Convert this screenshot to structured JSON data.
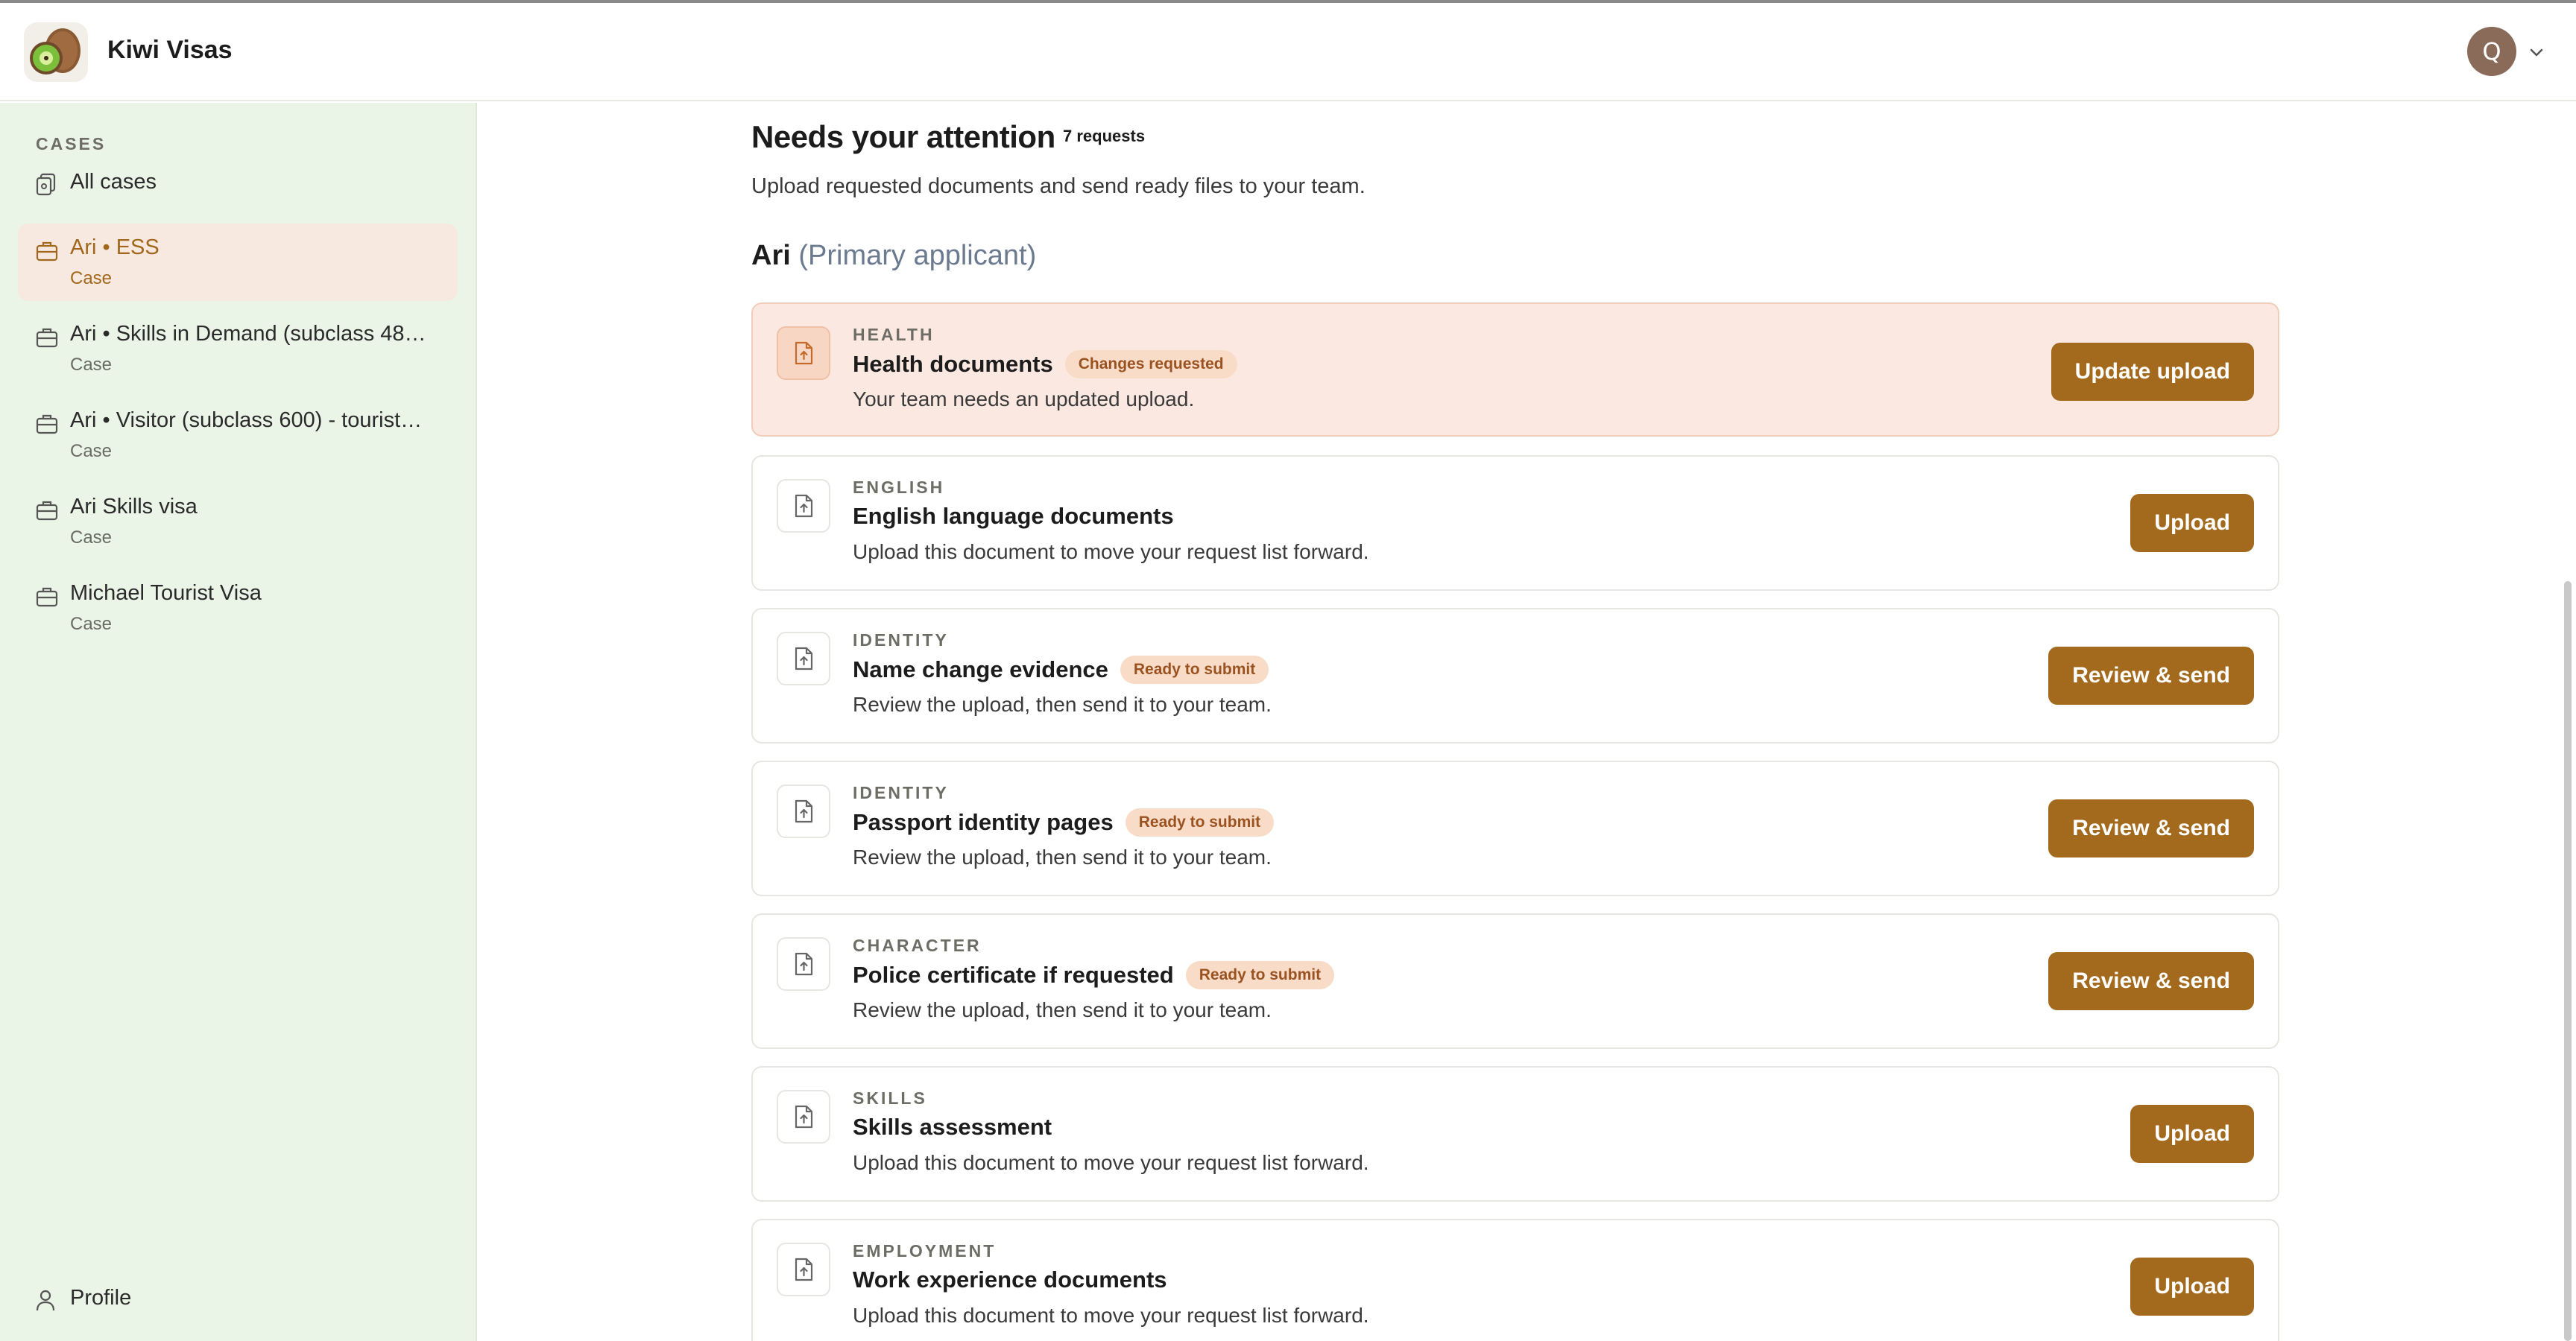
{
  "app": {
    "title": "Kiwi Visas",
    "avatar_initial": "Q"
  },
  "sidebar": {
    "section_label": "CASES",
    "items": [
      {
        "label": "All cases",
        "sub": "",
        "icon": "cases-icon",
        "active": false
      },
      {
        "label": "Ari • ESS",
        "sub": "Case",
        "icon": "briefcase-icon",
        "active": true
      },
      {
        "label": "Ari • Skills in Demand (subclass 48…",
        "sub": "Case",
        "icon": "briefcase-icon",
        "active": false
      },
      {
        "label": "Ari • Visitor (subclass 600) - tourist…",
        "sub": "Case",
        "icon": "briefcase-icon",
        "active": false
      },
      {
        "label": "Ari Skills visa",
        "sub": "Case",
        "icon": "briefcase-icon",
        "active": false
      },
      {
        "label": "Michael Tourist Visa",
        "sub": "Case",
        "icon": "briefcase-icon",
        "active": false
      }
    ],
    "profile_label": "Profile"
  },
  "main": {
    "heading": "Needs your attention",
    "count": "7 requests",
    "subheading": "Upload requested documents and send ready files to your team.",
    "applicant_name": "Ari",
    "applicant_role": "(Primary applicant)",
    "requests": [
      {
        "category": "HEALTH",
        "name": "Health documents",
        "badge": "Changes requested",
        "desc": "Your team needs an updated upload.",
        "action": "Update upload",
        "alert": true
      },
      {
        "category": "ENGLISH",
        "name": "English language documents",
        "badge": "",
        "desc": "Upload this document to move your request list forward.",
        "action": "Upload",
        "alert": false
      },
      {
        "category": "IDENTITY",
        "name": "Name change evidence",
        "badge": "Ready to submit",
        "desc": "Review the upload, then send it to your team.",
        "action": "Review & send",
        "alert": false
      },
      {
        "category": "IDENTITY",
        "name": "Passport identity pages",
        "badge": "Ready to submit",
        "desc": "Review the upload, then send it to your team.",
        "action": "Review & send",
        "alert": false
      },
      {
        "category": "CHARACTER",
        "name": "Police certificate if requested",
        "badge": "Ready to submit",
        "desc": "Review the upload, then send it to your team.",
        "action": "Review & send",
        "alert": false
      },
      {
        "category": "SKILLS",
        "name": "Skills assessment",
        "badge": "",
        "desc": "Upload this document to move your request list forward.",
        "action": "Upload",
        "alert": false
      },
      {
        "category": "EMPLOYMENT",
        "name": "Work experience documents",
        "badge": "",
        "desc": "Upload this document to move your request list forward.",
        "action": "Upload",
        "alert": false
      }
    ]
  },
  "colors": {
    "accent": "#a36a1d",
    "sidebar_bg": "#ebf5e7",
    "alert_bg": "#fbe9e1",
    "badge_bg": "#f8dcc8"
  }
}
